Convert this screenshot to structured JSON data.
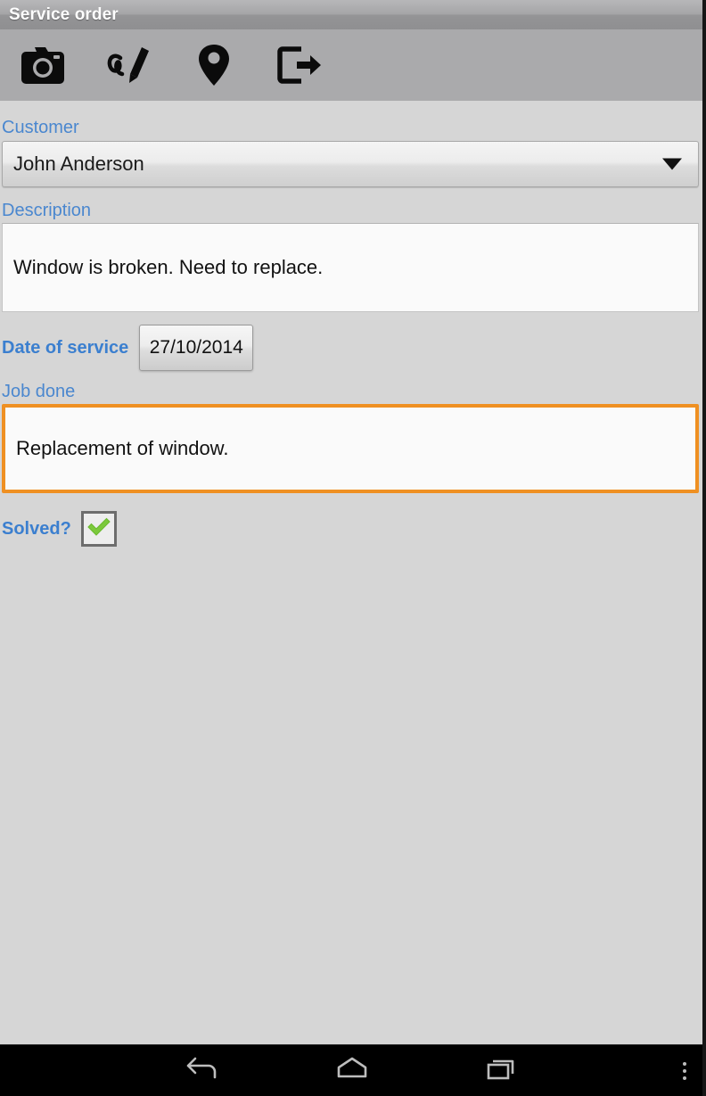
{
  "window": {
    "title": "Service order"
  },
  "toolbar": {
    "buttons": [
      {
        "name": "camera-icon",
        "label": "Take photo"
      },
      {
        "name": "signature-icon",
        "label": "Signature"
      },
      {
        "name": "location-icon",
        "label": "Location"
      },
      {
        "name": "export-icon",
        "label": "Export"
      }
    ]
  },
  "form": {
    "customer": {
      "label": "Customer",
      "value": "John Anderson",
      "dropdown_icon": "chevron-down-icon"
    },
    "description": {
      "label": "Description",
      "value": "Window is broken. Need to replace."
    },
    "date_of_service": {
      "label": "Date of service",
      "value": "27/10/2014"
    },
    "job_done": {
      "label": "Job done",
      "value": "Replacement of window.",
      "focused": true
    },
    "solved": {
      "label": "Solved?",
      "checked": true,
      "check_icon": "check-icon"
    }
  },
  "navbar": {
    "buttons": [
      {
        "name": "back-icon",
        "label": "Back"
      },
      {
        "name": "home-icon",
        "label": "Home"
      },
      {
        "name": "recents-icon",
        "label": "Recent apps"
      },
      {
        "name": "overflow-icon",
        "label": "More options"
      }
    ]
  },
  "colors": {
    "background": "#d6d6d6",
    "toolbar": "#aaaaac",
    "label_blue": "#3b7fcf",
    "focus_orange": "#ef9022",
    "check_green": "#7cc93c",
    "navbar": "#000000"
  }
}
